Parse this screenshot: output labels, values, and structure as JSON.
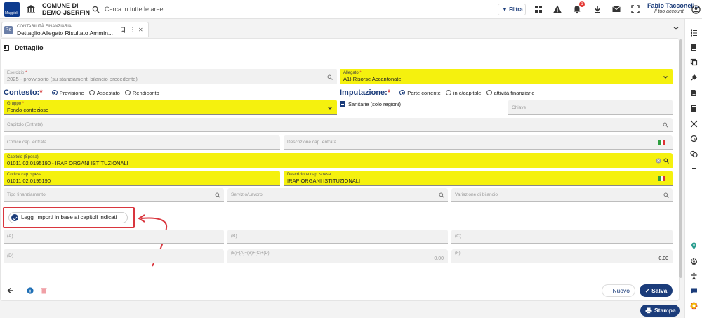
{
  "topbar": {
    "logo_text": "Maggioli",
    "comune_line1": "COMUNE DI",
    "comune_line2": "DEMO-JSERFIN",
    "search_placeholder": "Cerca in tutte le aree...",
    "filter_label": "Filtra",
    "notification_count": "1",
    "user_name": "Fabio Tacconell...",
    "user_sub": "Il tuo account"
  },
  "tab": {
    "badge": "Re",
    "module": "CONTABILITÀ FINANZIARIA",
    "title": "Dettaglio Allegato Risultato Ammin..."
  },
  "panel": {
    "title": "Dettaglio"
  },
  "form": {
    "esercizio": {
      "label": "Esercizio",
      "value": "2025 - provvisorio (su stanziamenti bilancio precedente)"
    },
    "allegato": {
      "label": "Allegato",
      "value": "A1) Risorse Accantonate"
    },
    "contesto": {
      "title": "Contesto:",
      "options": [
        "Previsione",
        "Assestato",
        "Rendiconto"
      ],
      "selected": 0
    },
    "imputazione": {
      "title": "Imputazione:",
      "options": [
        "Parte corrente",
        "in c/capitale",
        "attività finanziarie"
      ],
      "selected": 0
    },
    "gruppo": {
      "label": "Gruppo",
      "value": "Fondo contezioso"
    },
    "sanitarie_label": "Sanitarie (solo regioni)",
    "chiave_placeholder": "Chiave",
    "capitolo_entrata_placeholder": "Capitolo (Entrata)",
    "codice_cap_entrata_placeholder": "Codice cap. entrata",
    "descrizione_cap_entrata_placeholder": "Descrizione cap. entrata",
    "capitolo_spesa": {
      "label": "Capitolo (Spesa)",
      "value": "01011.02.0195190 - IRAP ORGANI ISTITUZIONALI"
    },
    "codice_cap_spesa": {
      "label": "Codice cap. spesa",
      "value": "01011.02.0195190"
    },
    "descrizione_cap_spesa": {
      "label": "Descrizione cap. spesa",
      "value": "IRAP ORGANI ISTITUZIONALI"
    },
    "tipo_finanziamento_placeholder": "Tipo finanziamento",
    "servizio_placeholder": "Servizio/Lavoro",
    "variazione_placeholder": "Variazione di bilancio",
    "leggi_label": "Leggi importi in base ai capitoli indicati",
    "a_label": "(A)",
    "b_label": "(B)",
    "c_label": "(C)",
    "d_label": "(D)",
    "e_label": "(E)=(A)+(B)+(C)+(D)",
    "e_value": "0,00",
    "f_label": "(F)",
    "f_value": "0,00"
  },
  "footer": {
    "nuovo_label": "Nuovo",
    "salva_label": "Salva",
    "stampa_label": "Stampa"
  },
  "colors": {
    "accent": "#1b3c7a",
    "highlight": "#f5f10e",
    "annotation": "#d9363e"
  }
}
